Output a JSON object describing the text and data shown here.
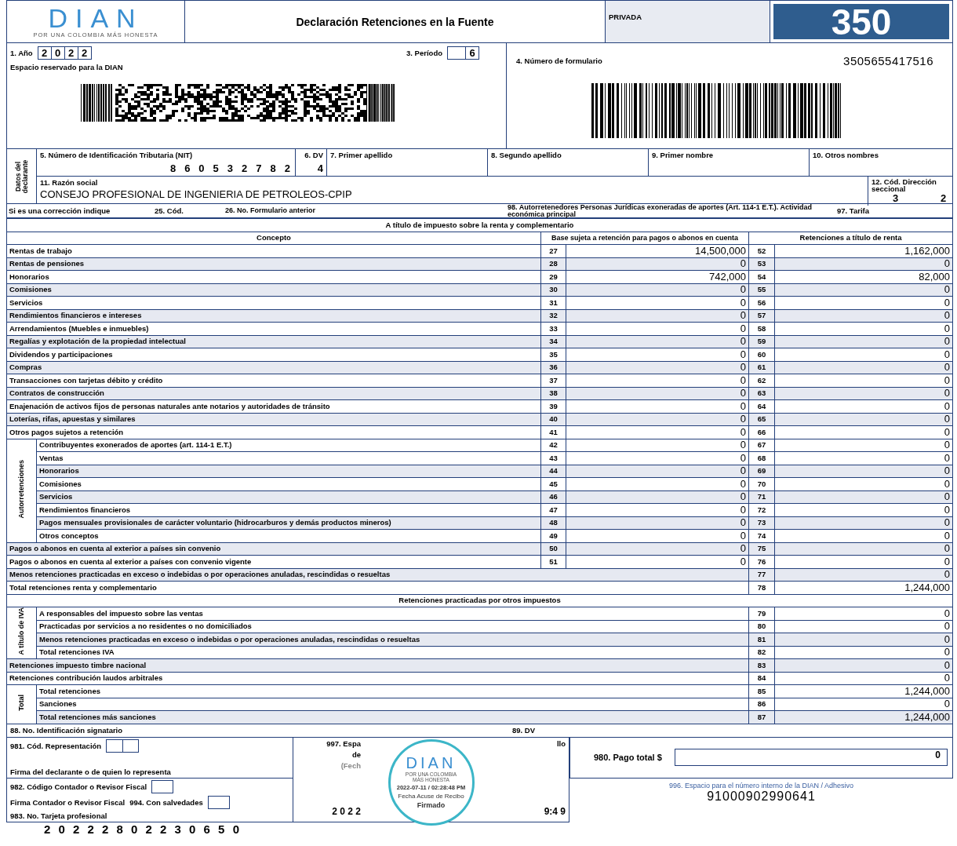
{
  "header": {
    "logo": "DIAN",
    "logo_tagline": "POR UNA COLOMBIA MÁS HONESTA",
    "title": "Declaración Retenciones en la Fuente",
    "privacy": "PRIVADA",
    "form_code": "350"
  },
  "top": {
    "year_label": "1. Año",
    "year_digits": [
      "2",
      "0",
      "2",
      "2"
    ],
    "period_label": "3. Período",
    "period": "6",
    "reserved_label": "Espacio reservado para la DIAN",
    "form_number_label": "4. Número de formulario",
    "form_number": "3505655417516"
  },
  "declarant": {
    "side_label": "Datos del declarante",
    "nit_label": "5. Número de Identificación Tributaria (NIT)",
    "nit_digits": [
      "8",
      "6",
      "0",
      "5",
      "3",
      "2",
      "7",
      "8",
      "2"
    ],
    "dv_label": "6. DV",
    "dv": "4",
    "first_surname_label": "7. Primer apellido",
    "second_surname_label": "8. Segundo apellido",
    "first_name_label": "9. Primer nombre",
    "other_names_label": "10. Otros nombres",
    "business_name_label": "11. Razón social",
    "business_name": "CONSEJO PROFESIONAL DE INGENIERIA DE PETROLEOS-CPIP",
    "seccional_label": "12. Cód. Dirección seccional",
    "seccional_digits": [
      "3",
      "2"
    ]
  },
  "corrections": {
    "correction_label": "Si es una corrección indique",
    "code_label": "25. Cód.",
    "previous_form_label": "26. No. Formulario anterior",
    "exonerated_label": "98. Autorretenedores Personas Jurídicas exoneradas de aportes (Art. 114-1 E.T.). Actividad económica principal",
    "rate_label": "97. Tarifa"
  },
  "income_section": {
    "title": "A título de impuesto sobre la renta y complementario",
    "columns": [
      "Concepto",
      "Base sujeta a retención para pagos o abonos en cuenta",
      "Retenciones a título de renta"
    ],
    "rows": [
      {
        "kind": "line",
        "concept": "Rentas de trabajo",
        "base_code": "27",
        "base": "14,500,000",
        "ret_code": "52",
        "ret": "1,162,000"
      },
      {
        "kind": "line",
        "concept": "Rentas de pensiones",
        "base_code": "28",
        "base": "0",
        "ret_code": "53",
        "ret": "0"
      },
      {
        "kind": "line",
        "concept": "Honorarios",
        "base_code": "29",
        "base": "742,000",
        "ret_code": "54",
        "ret": "82,000"
      },
      {
        "kind": "line",
        "concept": "Comisiones",
        "base_code": "30",
        "base": "0",
        "ret_code": "55",
        "ret": "0"
      },
      {
        "kind": "line",
        "concept": "Servicios",
        "base_code": "31",
        "base": "0",
        "ret_code": "56",
        "ret": "0"
      },
      {
        "kind": "line",
        "concept": "Rendimientos financieros e intereses",
        "base_code": "32",
        "base": "0",
        "ret_code": "57",
        "ret": "0"
      },
      {
        "kind": "line",
        "concept": "Arrendamientos (Muebles e inmuebles)",
        "base_code": "33",
        "base": "0",
        "ret_code": "58",
        "ret": "0"
      },
      {
        "kind": "line",
        "concept": "Regalías y explotación de la propiedad intelectual",
        "base_code": "34",
        "base": "0",
        "ret_code": "59",
        "ret": "0"
      },
      {
        "kind": "line",
        "concept": "Dividendos y participaciones",
        "base_code": "35",
        "base": "0",
        "ret_code": "60",
        "ret": "0"
      },
      {
        "kind": "line",
        "concept": "Compras",
        "base_code": "36",
        "base": "0",
        "ret_code": "61",
        "ret": "0"
      },
      {
        "kind": "line",
        "concept": "Transacciones con tarjetas débito y crédito",
        "base_code": "37",
        "base": "0",
        "ret_code": "62",
        "ret": "0"
      },
      {
        "kind": "line",
        "concept": "Contratos de construcción",
        "base_code": "38",
        "base": "0",
        "ret_code": "63",
        "ret": "0"
      },
      {
        "kind": "line",
        "concept": "Enajenación de activos fijos  de personas naturales ante notarios y autoridades de tránsito",
        "base_code": "39",
        "base": "0",
        "ret_code": "64",
        "ret": "0"
      },
      {
        "kind": "line",
        "concept": "Loterías, rifas, apuestas y similares",
        "base_code": "40",
        "base": "0",
        "ret_code": "65",
        "ret": "0"
      },
      {
        "kind": "line",
        "concept": "Otros pagos sujetos a retención",
        "base_code": "41",
        "base": "0",
        "ret_code": "66",
        "ret": "0"
      },
      {
        "kind": "group",
        "label": "Autorretenciones",
        "rows": [
          {
            "kind": "line",
            "concept": "Contribuyentes exonerados de aportes (art. 114-1 E.T.)",
            "base_code": "42",
            "base": "0",
            "ret_code": "67",
            "ret": "0"
          },
          {
            "kind": "line",
            "concept": "Ventas",
            "base_code": "43",
            "base": "0",
            "ret_code": "68",
            "ret": "0"
          },
          {
            "kind": "line",
            "concept": "Honorarios",
            "base_code": "44",
            "base": "0",
            "ret_code": "69",
            "ret": "0"
          },
          {
            "kind": "line",
            "concept": "Comisiones",
            "base_code": "45",
            "base": "0",
            "ret_code": "70",
            "ret": "0"
          },
          {
            "kind": "line",
            "concept": "Servicios",
            "base_code": "46",
            "base": "0",
            "ret_code": "71",
            "ret": "0"
          },
          {
            "kind": "line",
            "concept": "Rendimientos financieros",
            "base_code": "47",
            "base": "0",
            "ret_code": "72",
            "ret": "0"
          },
          {
            "kind": "line",
            "concept": "Pagos mensuales provisionales de carácter voluntario (hidrocarburos y demás productos mineros)",
            "base_code": "48",
            "base": "0",
            "ret_code": "73",
            "ret": "0"
          },
          {
            "kind": "line",
            "concept": "Otros conceptos",
            "base_code": "49",
            "base": "0",
            "ret_code": "74",
            "ret": "0"
          }
        ]
      },
      {
        "kind": "line",
        "concept": "Pagos o abonos en cuenta al exterior a países sin convenio",
        "base_code": "50",
        "base": "0",
        "ret_code": "75",
        "ret": "0"
      },
      {
        "kind": "line",
        "concept": "Pagos o abonos en cuenta al exterior a países con convenio vigente",
        "base_code": "51",
        "base": "0",
        "ret_code": "76",
        "ret": "0"
      },
      {
        "kind": "summary",
        "concept": "Menos retenciones practicadas en exceso o indebidas o por operaciones anuladas, rescindidas o resueltas",
        "ret_code": "77",
        "ret": "0"
      },
      {
        "kind": "summary",
        "concept": "Total retenciones renta y complementario",
        "ret_code": "78",
        "ret": "1,244,000"
      }
    ]
  },
  "other_taxes_section": {
    "title": "Retenciones practicadas por otros impuestos",
    "rows": [
      {
        "kind": "group",
        "label": "A título de IVA",
        "rows": [
          {
            "kind": "summary",
            "concept": "A responsables del impuesto sobre las ventas",
            "ret_code": "79",
            "ret": "0"
          },
          {
            "kind": "summary",
            "concept": "Practicadas por servicios a no residentes o no domiciliados",
            "ret_code": "80",
            "ret": "0"
          },
          {
            "kind": "summary",
            "concept": "Menos retenciones practicadas en exceso o indebidas o por operaciones anuladas, rescindidas o resueltas",
            "ret_code": "81",
            "ret": "0"
          },
          {
            "kind": "summary",
            "concept": "Total retenciones IVA",
            "ret_code": "82",
            "ret": "0"
          }
        ]
      },
      {
        "kind": "summary",
        "concept": "Retenciones impuesto timbre nacional",
        "ret_code": "83",
        "ret": "0"
      },
      {
        "kind": "summary",
        "concept": "Retenciones contribución laudos arbitrales",
        "ret_code": "84",
        "ret": "0"
      },
      {
        "kind": "group",
        "label": "Total",
        "rows": [
          {
            "kind": "summary",
            "concept": "Total retenciones",
            "ret_code": "85",
            "ret": "1,244,000"
          },
          {
            "kind": "summary",
            "concept": "Sanciones",
            "ret_code": "86",
            "ret": "0"
          },
          {
            "kind": "summary",
            "concept": "Total retenciones más sanciones",
            "ret_code": "87",
            "ret": "1,244,000"
          }
        ]
      }
    ]
  },
  "signatory": {
    "id_label": "88. No. Identificación signatario",
    "dv_label": "89. DV",
    "representation_label": "981. Cód. Representación",
    "declarant_signature_label": "Firma del declarante o de quien lo representa",
    "accountant_code_label": "982. Código Contador o Revisor Fiscal",
    "accountant_signature_label": "Firma Contador o Revisor Fiscal",
    "qualified_label": "994. Con salvedades",
    "card_label": "983. No. Tarjeta profesional"
  },
  "reception": {
    "label_start": "997. Espa",
    "label_end": "llo",
    "label_line2": "de",
    "date_label": "(Fech",
    "date_start": "2 0 2 2",
    "date_end": "9:4 9"
  },
  "seal": {
    "logo": "DIAN",
    "tagline": "POR UNA COLOMBIA MÁS HONESTA",
    "timestamp": "2022-07-11 / 02:28:48 PM",
    "caption": "Fecha Acuse de Recibo",
    "status": "Firmado"
  },
  "payment": {
    "label": "980. Pago total $",
    "value": "0",
    "internal_label": "996. Espacio para el número interno de la DIAN / Adhesivo",
    "internal_number": "91000902990641"
  },
  "footer_number": "2 0 2 2 2 8 0 2 2 3 0 6 5 0"
}
